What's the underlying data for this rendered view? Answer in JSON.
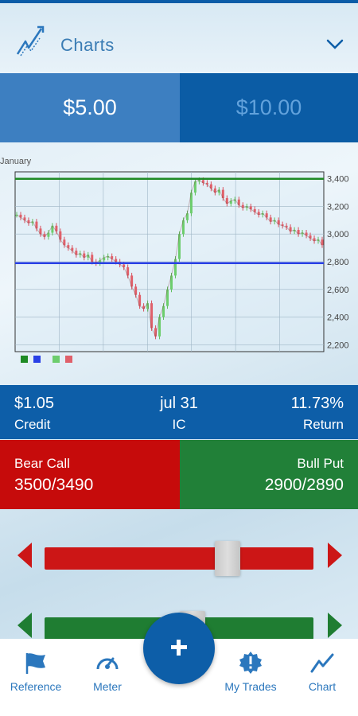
{
  "header": {
    "title": "Charts",
    "logo_icon": "chart-trend-icon",
    "menu_icon": "chevron-down-icon"
  },
  "prices": {
    "left": "$5.00",
    "right": "$10.00",
    "selected": "left"
  },
  "chart_data": {
    "type": "candlestick-line",
    "xlabel_top": "January",
    "ylim": [
      2150,
      3450
    ],
    "yticks": [
      "3,400",
      "3,200",
      "3,000",
      "2,800",
      "2,600",
      "2,400",
      "2,200"
    ],
    "ytick_values": [
      3400,
      3200,
      3000,
      2800,
      2600,
      2400,
      2200
    ],
    "hlines": [
      {
        "value": 3400,
        "color": "#1e8a24"
      },
      {
        "value": 2790,
        "color": "#2940e6"
      }
    ],
    "close_series": [
      3140,
      3120,
      3100,
      3080,
      3090,
      3040,
      3000,
      2980,
      3010,
      3060,
      3020,
      2960,
      2920,
      2900,
      2880,
      2850,
      2860,
      2830,
      2850,
      2800,
      2790,
      2810,
      2830,
      2840,
      2820,
      2800,
      2780,
      2760,
      2700,
      2620,
      2560,
      2480,
      2460,
      2500,
      2320,
      2260,
      2400,
      2480,
      2600,
      2700,
      2820,
      3000,
      3100,
      3150,
      3300,
      3380,
      3390,
      3370,
      3360,
      3330,
      3300,
      3320,
      3260,
      3220,
      3240,
      3250,
      3210,
      3190,
      3200,
      3180,
      3160,
      3140,
      3150,
      3120,
      3090,
      3100,
      3070,
      3060,
      3050,
      3020,
      3030,
      3000,
      3010,
      2990,
      2970,
      2950,
      2960,
      2920
    ],
    "legend_colors": [
      "#1e8a24",
      "#2940e6",
      "#6dcd6d",
      "#e0606a"
    ]
  },
  "info": {
    "credit_value": "$1.05",
    "credit_label": "Credit",
    "expiry_value": "jul 31",
    "expiry_label": "IC",
    "return_value": "11.73%",
    "return_label": "Return"
  },
  "legs": {
    "bear_name": "Bear Call",
    "bear_strikes": "3500/3490",
    "bull_name": "Bull Put",
    "bull_strikes": "2900/2890"
  },
  "sliders": {
    "red_level": 0.68,
    "green_level": 0.55,
    "red_color": "#cc1616",
    "green_color": "#1f7d32"
  },
  "nav": {
    "items": [
      {
        "label": "Reference",
        "icon": "flag-icon"
      },
      {
        "label": "Meter",
        "icon": "gauge-icon"
      },
      {
        "label": "My Trades",
        "icon": "alert-badge-icon"
      },
      {
        "label": "Chart",
        "icon": "chart-line-icon"
      }
    ],
    "fab_icon": "plus-icon"
  }
}
